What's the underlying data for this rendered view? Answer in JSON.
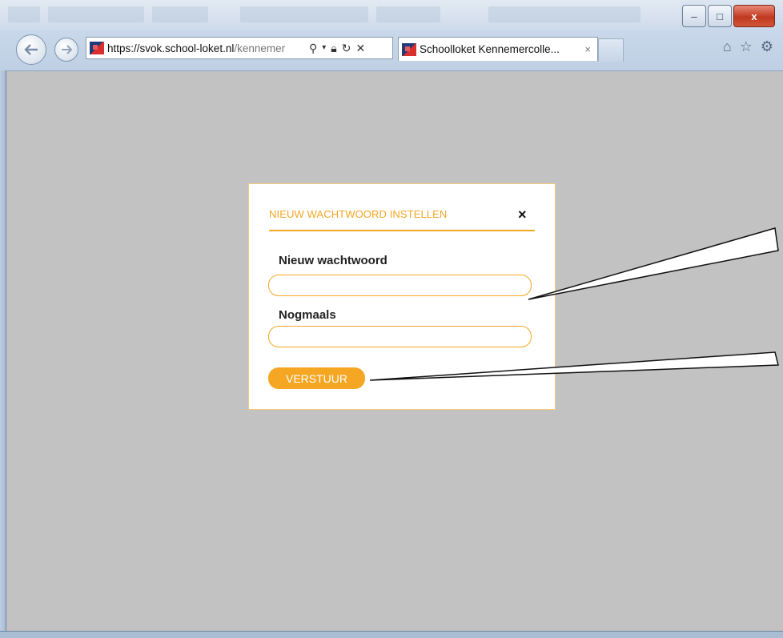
{
  "browser": {
    "url_host": "https://svok.school-loket.nl",
    "url_path": "/kennemer",
    "tab_title": "Schoolloket Kennemercolle...",
    "tab_close": "×",
    "icons": [
      "back-icon",
      "forward-icon",
      "search-icon",
      "dropdown-icon",
      "lock-icon",
      "refresh-icon",
      "stop-icon",
      "home-icon",
      "favorites-star-icon",
      "settings-gear-icon"
    ],
    "window_buttons": {
      "minimize": "–",
      "maximize": "□",
      "close": "x"
    }
  },
  "modal": {
    "title": "NIEUW WACHTWOORD INSTELLEN",
    "close_label": "×",
    "fields": [
      {
        "label": "Nieuw wachtwoord",
        "value": ""
      },
      {
        "label": "Nogmaals",
        "value": ""
      }
    ],
    "submit_label": "VERSTUUR"
  },
  "colors": {
    "accent": "#f5a623",
    "page_background": "#c2c2c2"
  }
}
